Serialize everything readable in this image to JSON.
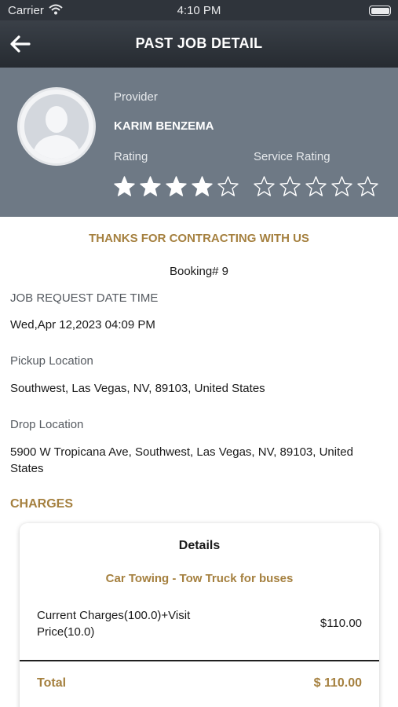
{
  "status_bar": {
    "carrier": "Carrier",
    "time": "4:10 PM"
  },
  "header": {
    "title": "PAST JOB DETAIL",
    "back_icon": "arrow-left-icon"
  },
  "provider": {
    "label": "Provider",
    "name": "KARIM BENZEMA",
    "rating_label": "Rating",
    "rating": 4,
    "rating_max": 5,
    "service_rating_label": "Service Rating",
    "service_rating": 0,
    "service_rating_max": 5
  },
  "thanks_text": "THANKS FOR CONTRACTING WITH US",
  "booking_text": "Booking# 9",
  "fields": {
    "request_label": "JOB REQUEST DATE TIME",
    "request_value": "Wed,Apr 12,2023 04:09 PM",
    "pickup_label": "Pickup Location",
    "pickup_value": "Southwest, Las Vegas, NV, 89103, United States",
    "drop_label": "Drop Location",
    "drop_value": "5900 W Tropicana Ave, Southwest, Las Vegas, NV, 89103, United States"
  },
  "charges": {
    "section_title": "CHARGES",
    "details_title": "Details",
    "service_name": "Car Towing - Tow Truck for buses",
    "charge_desc": "Current Charges(100.0)+Visit Price(10.0)",
    "charge_amount": "$110.00",
    "total_label": "Total",
    "total_value": "$ 110.00"
  },
  "colors": {
    "accent": "#a5803f",
    "header_bg": "#2f343b",
    "provider_bg": "#6e7985",
    "star_filled": "#ffffff"
  }
}
